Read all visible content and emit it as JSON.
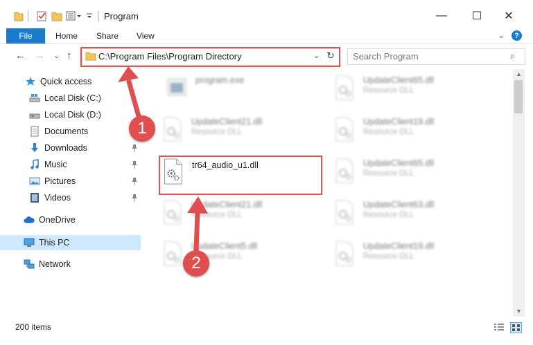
{
  "window": {
    "title": "Program",
    "min_glyph": "—",
    "max_glyph": "☐",
    "close_glyph": "✕"
  },
  "ribbon": {
    "file_tab": "File",
    "tabs": [
      "Home",
      "Share",
      "View"
    ],
    "expand_glyph": "⌄",
    "help_glyph": "?"
  },
  "nav": {
    "back_glyph": "←",
    "forward_glyph": "→",
    "recent_glyph": "⌄",
    "up_glyph": "↑",
    "address": "C:\\Program Files\\Program Directory",
    "address_chev": "⌄",
    "refresh_glyph": "↻",
    "search_placeholder": "Search Program",
    "search_glyph": "⌕"
  },
  "sidebar": {
    "items": [
      {
        "label": "Quick access",
        "icon": "star-icon",
        "pinned": false
      },
      {
        "label": "Local Disk (C:)",
        "icon": "drive-icon",
        "pinned": false
      },
      {
        "label": "Local Disk (D:)",
        "icon": "drive-icon",
        "pinned": false
      },
      {
        "label": "Documents",
        "icon": "documents-icon",
        "pinned": true
      },
      {
        "label": "Downloads",
        "icon": "download-icon",
        "pinned": true
      },
      {
        "label": "Music",
        "icon": "music-icon",
        "pinned": true
      },
      {
        "label": "Pictures",
        "icon": "pictures-icon",
        "pinned": true
      },
      {
        "label": "Videos",
        "icon": "videos-icon",
        "pinned": true
      },
      {
        "label": "OneDrive",
        "icon": "cloud-icon",
        "pinned": false
      },
      {
        "label": "This PC",
        "icon": "computer-icon",
        "pinned": false,
        "selected": true
      },
      {
        "label": "Network",
        "icon": "network-icon",
        "pinned": false
      }
    ],
    "pin_glyph": "📌"
  },
  "files": [
    {
      "name": "program.exe",
      "type": ""
    },
    {
      "name": "UpdateClient65.dll",
      "type": "Resource DLL"
    },
    {
      "name": "UpdateClient21.dll",
      "type": "Resource DLL"
    },
    {
      "name": "UpdateClient19.dll",
      "type": "Resource DLL"
    },
    {
      "name": "tr64_audio_u1.dll",
      "type": ""
    },
    {
      "name": "UpdateClient65.dll",
      "type": "Resource DLL"
    },
    {
      "name": "UpdateClient21.dll",
      "type": "Resource DLL"
    },
    {
      "name": "UpdateClient63.dll",
      "type": "Resource DLL"
    },
    {
      "name": "UpdateClient5.dll",
      "type": "Resource DLL"
    },
    {
      "name": "UpdateClient19.dll",
      "type": "Resource DLL"
    }
  ],
  "status": {
    "count": "200 items"
  },
  "annotations": {
    "step1": "1",
    "step2": "2"
  },
  "colors": {
    "accent": "#1979ca",
    "highlight": "#e05151",
    "selected_bg": "#cde8ff"
  }
}
